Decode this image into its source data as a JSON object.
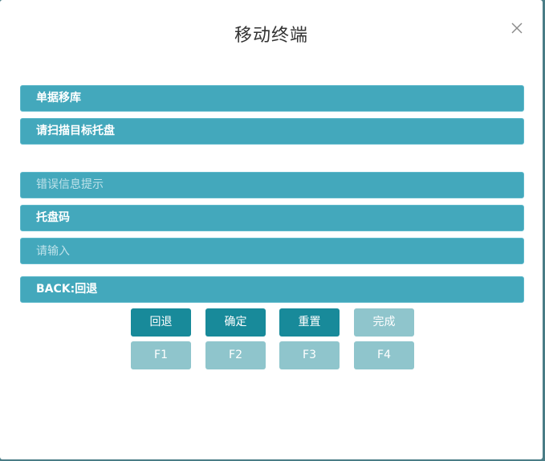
{
  "dialog": {
    "title": "移动终端"
  },
  "bars": {
    "mode": "单据移库",
    "prompt": "请扫描目标托盘",
    "error": "错误信息提示",
    "pallet_label": "托盘码",
    "input_placeholder": "请输入",
    "back_hint": "BACK:回退"
  },
  "buttons": {
    "back": "回退",
    "confirm": "确定",
    "reset": "重置",
    "finish": "完成",
    "f1": "F1",
    "f2": "F2",
    "f3": "F3",
    "f4": "F4"
  },
  "icons": {
    "close": "close-icon"
  },
  "colors": {
    "bar": "#43a8bc",
    "button_active": "#188a9a",
    "button_inactive": "#8fc5cc"
  }
}
